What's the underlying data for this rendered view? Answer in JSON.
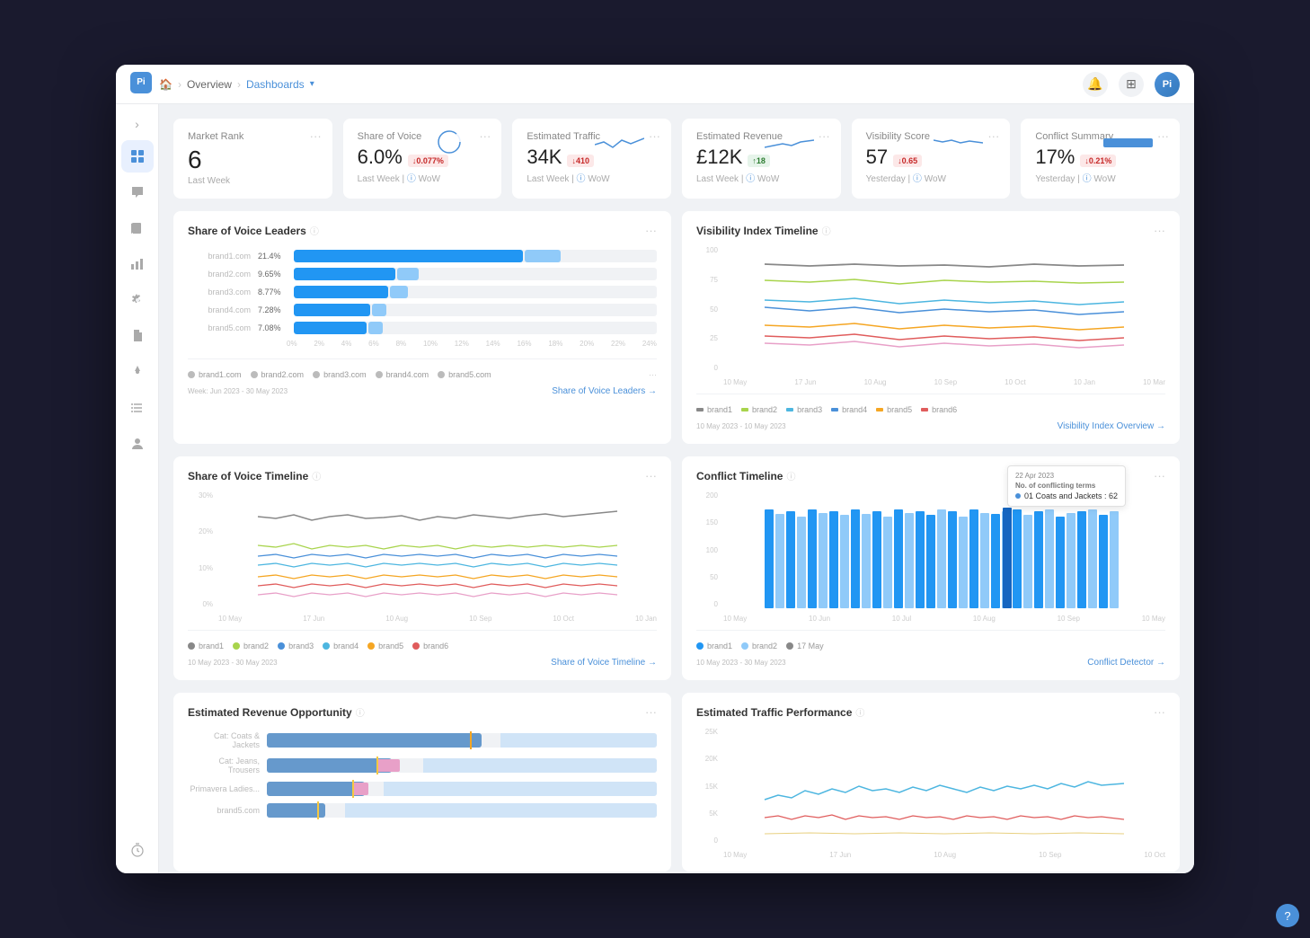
{
  "header": {
    "breadcrumb": {
      "home": "🏠",
      "overview": "Overview",
      "dashboards": "Dashboards"
    },
    "icons": [
      "🔔",
      "⊞"
    ],
    "avatar_initials": "Pi"
  },
  "sidebar": {
    "logo": "Pi",
    "items": [
      {
        "name": "toggle",
        "icon": "›",
        "active": false
      },
      {
        "name": "dashboard",
        "icon": "⊞",
        "active": true
      },
      {
        "name": "chat",
        "icon": "💬",
        "active": false
      },
      {
        "name": "book",
        "icon": "📖",
        "active": false
      },
      {
        "name": "chart",
        "icon": "📊",
        "active": false
      },
      {
        "name": "settings",
        "icon": "⚙️",
        "active": false
      },
      {
        "name": "file",
        "icon": "📄",
        "active": false
      },
      {
        "name": "pin",
        "icon": "📍",
        "active": false
      },
      {
        "name": "list",
        "icon": "☰",
        "active": false
      },
      {
        "name": "user",
        "icon": "👤",
        "active": false
      }
    ],
    "bottom_icon": "⏱"
  },
  "kpi_cards": [
    {
      "title": "Market Rank",
      "value": "6",
      "sub": "Last Week",
      "badge": null,
      "badge_type": null,
      "sparkline": false
    },
    {
      "title": "Share of Voice",
      "value": "6.0%",
      "badge_text": "↓0.077%",
      "badge_type": "red",
      "sub_left": "Last Week",
      "sub_right": "WoW",
      "sparkline": true
    },
    {
      "title": "Estimated Traffic",
      "value": "34K",
      "badge_text": "↓410",
      "badge_type": "red",
      "sub_left": "Last Week",
      "sub_right": "WoW",
      "sparkline": true
    },
    {
      "title": "Estimated Revenue",
      "value": "£12K",
      "badge_text": "↑18",
      "badge_type": "green",
      "sub_left": "Last Week",
      "sub_right": "WoW",
      "sparkline": true
    },
    {
      "title": "Visibility Score",
      "value": "57",
      "badge_text": "↓0.65",
      "badge_type": "red",
      "sub_left": "Yesterday",
      "sub_right": "WoW",
      "sparkline": true
    },
    {
      "title": "Conflict Summary",
      "value": "17%",
      "badge_text": "↓0.21%",
      "badge_type": "red",
      "sub_left": "Yesterday",
      "sub_right": "WoW",
      "sparkline": true
    }
  ],
  "charts": {
    "share_of_voice_leaders": {
      "title": "Share of Voice Leaders",
      "bars": [
        {
          "label": "brand1.com",
          "pct": 21.4,
          "display": "21.4%"
        },
        {
          "label": "brand2.com",
          "pct": 9.65,
          "display": "9.65%"
        },
        {
          "label": "brand3.com",
          "pct": 8.77,
          "display": "8.77%"
        },
        {
          "label": "brand4.com",
          "pct": 7.28,
          "display": "7.28%"
        },
        {
          "label": "brand5.com",
          "pct": 7.08,
          "display": "7.08%"
        }
      ],
      "axis_labels": [
        "0%",
        "2%",
        "4%",
        "6%",
        "8%",
        "10%",
        "12%",
        "14%",
        "16%",
        "18%",
        "20%",
        "22%",
        "24%"
      ],
      "link": "Share of Voice Leaders →",
      "date_range": "Week: Jun 2023 - 30 May 2023"
    },
    "visibility_index_timeline": {
      "title": "Visibility Index Timeline",
      "link": "Visibility Index Overview →",
      "date_range": "10 May 2023 - 10 May 2023",
      "y_max": 100,
      "y_labels": [
        "100",
        "75",
        "50",
        "25",
        "0"
      ],
      "lines": [
        {
          "color": "#888888",
          "opacity": 0.9
        },
        {
          "color": "#a8d44c",
          "opacity": 0.9
        },
        {
          "color": "#4db6e0",
          "opacity": 0.9
        },
        {
          "color": "#4a90d9",
          "opacity": 0.9
        },
        {
          "color": "#f5a623",
          "opacity": 0.9
        },
        {
          "color": "#e05c5c",
          "opacity": 0.9
        },
        {
          "color": "#e8a0c8",
          "opacity": 0.9
        }
      ]
    },
    "share_of_voice_timeline": {
      "title": "Share of Voice Timeline",
      "link": "Share of Voice Timeline →",
      "date_range": "10 May 2023 - 30 May 2023",
      "y_labels": [
        "30%",
        "20%",
        "10%",
        "0%"
      ],
      "lines": [
        {
          "color": "#888888"
        },
        {
          "color": "#a8d44c"
        },
        {
          "color": "#4a90d9"
        },
        {
          "color": "#4db6e0"
        },
        {
          "color": "#f5a623"
        },
        {
          "color": "#e05c5c"
        },
        {
          "color": "#e8a0c8"
        }
      ]
    },
    "conflict_timeline": {
      "title": "Conflict Timeline",
      "link": "Conflict Detector →",
      "date_range": "10 May 2023 - 30 May 2023",
      "y_labels": [
        "200",
        "150",
        "100",
        "50",
        "0"
      ],
      "tooltip": {
        "date": "22 Apr 2023",
        "label": "No. of conflicting terms",
        "item": "01 Coats and Jackets : 62"
      }
    },
    "estimated_revenue_opportunity": {
      "title": "Estimated Revenue Opportunity",
      "bars": [
        {
          "label": "Cat: Coats & Jackets",
          "filled": 55,
          "marker": 52
        },
        {
          "label": "Cat: Jeans, Trousers",
          "filled": 35,
          "marker": 30
        },
        {
          "label": "Primavera Ladies, Time...",
          "filled": 28,
          "marker": 28
        },
        {
          "label": "brand5.com",
          "filled": 15,
          "marker": 15
        }
      ]
    },
    "estimated_traffic_performance": {
      "title": "Estimated Traffic Performance",
      "y_labels": [
        "25K",
        "20K",
        "15K",
        "5K",
        "0"
      ],
      "lines": [
        {
          "color": "#4db6e0"
        },
        {
          "color": "#e05c5c"
        },
        {
          "color": "#f5e4a0"
        }
      ]
    }
  }
}
